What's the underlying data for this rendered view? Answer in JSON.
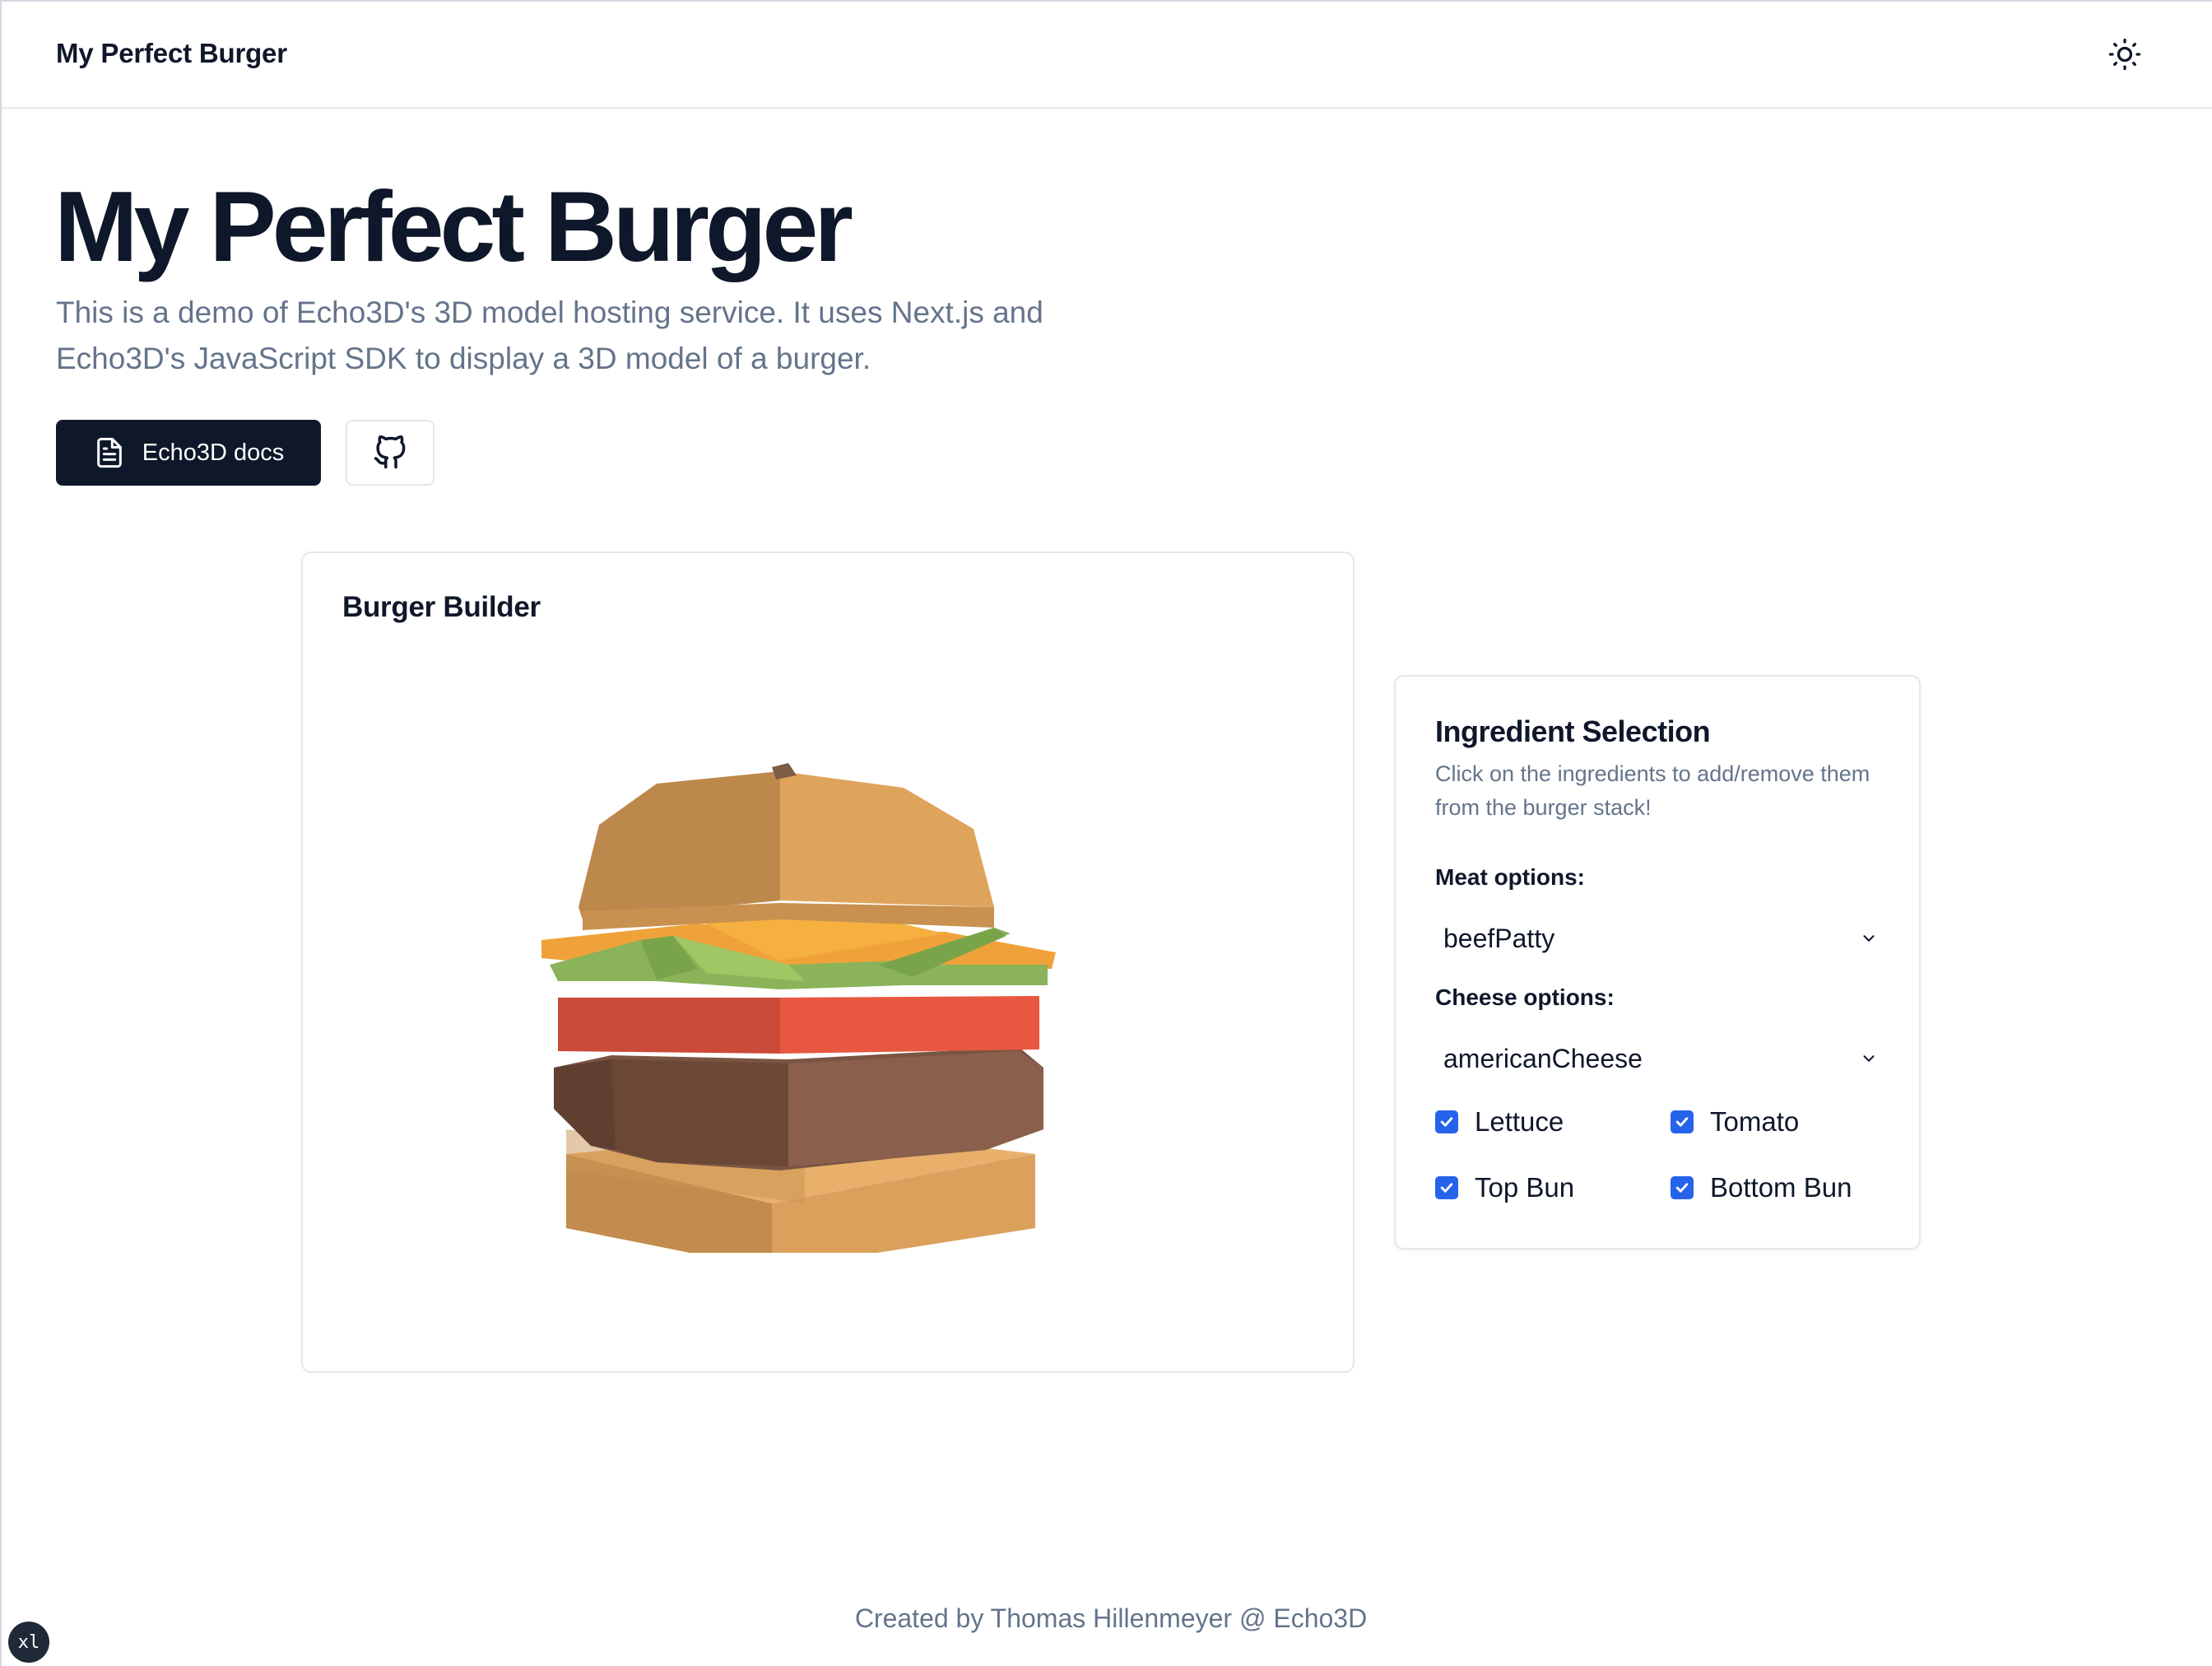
{
  "header": {
    "brand": "My Perfect Burger",
    "theme_icon": "sun-icon"
  },
  "hero": {
    "title": "My Perfect Burger",
    "description": "This is a demo of Echo3D's 3D model hosting service. It uses Next.js and Echo3D's JavaScript SDK to display a 3D model of a burger.",
    "docs_button": "Echo3D docs",
    "docs_icon": "document-icon",
    "github_icon": "github-icon"
  },
  "builder": {
    "title": "Burger Builder"
  },
  "ingredients": {
    "title": "Ingredient Selection",
    "description": "Click on the ingredients to add/remove them from the burger stack!",
    "meat_label": "Meat options:",
    "meat_value": "beefPatty",
    "cheese_label": "Cheese options:",
    "cheese_value": "americanCheese",
    "toggles": [
      {
        "label": "Lettuce",
        "checked": true
      },
      {
        "label": "Tomato",
        "checked": true
      },
      {
        "label": "Top Bun",
        "checked": true
      },
      {
        "label": "Bottom Bun",
        "checked": true
      }
    ]
  },
  "footer": {
    "credit": "Created by Thomas Hillenmeyer @ Echo3D"
  },
  "badge": {
    "text": "xl"
  },
  "colors": {
    "primary": "#0f172a",
    "muted": "#64748b",
    "checkbox": "#2563eb",
    "border": "#e5e7eb"
  }
}
